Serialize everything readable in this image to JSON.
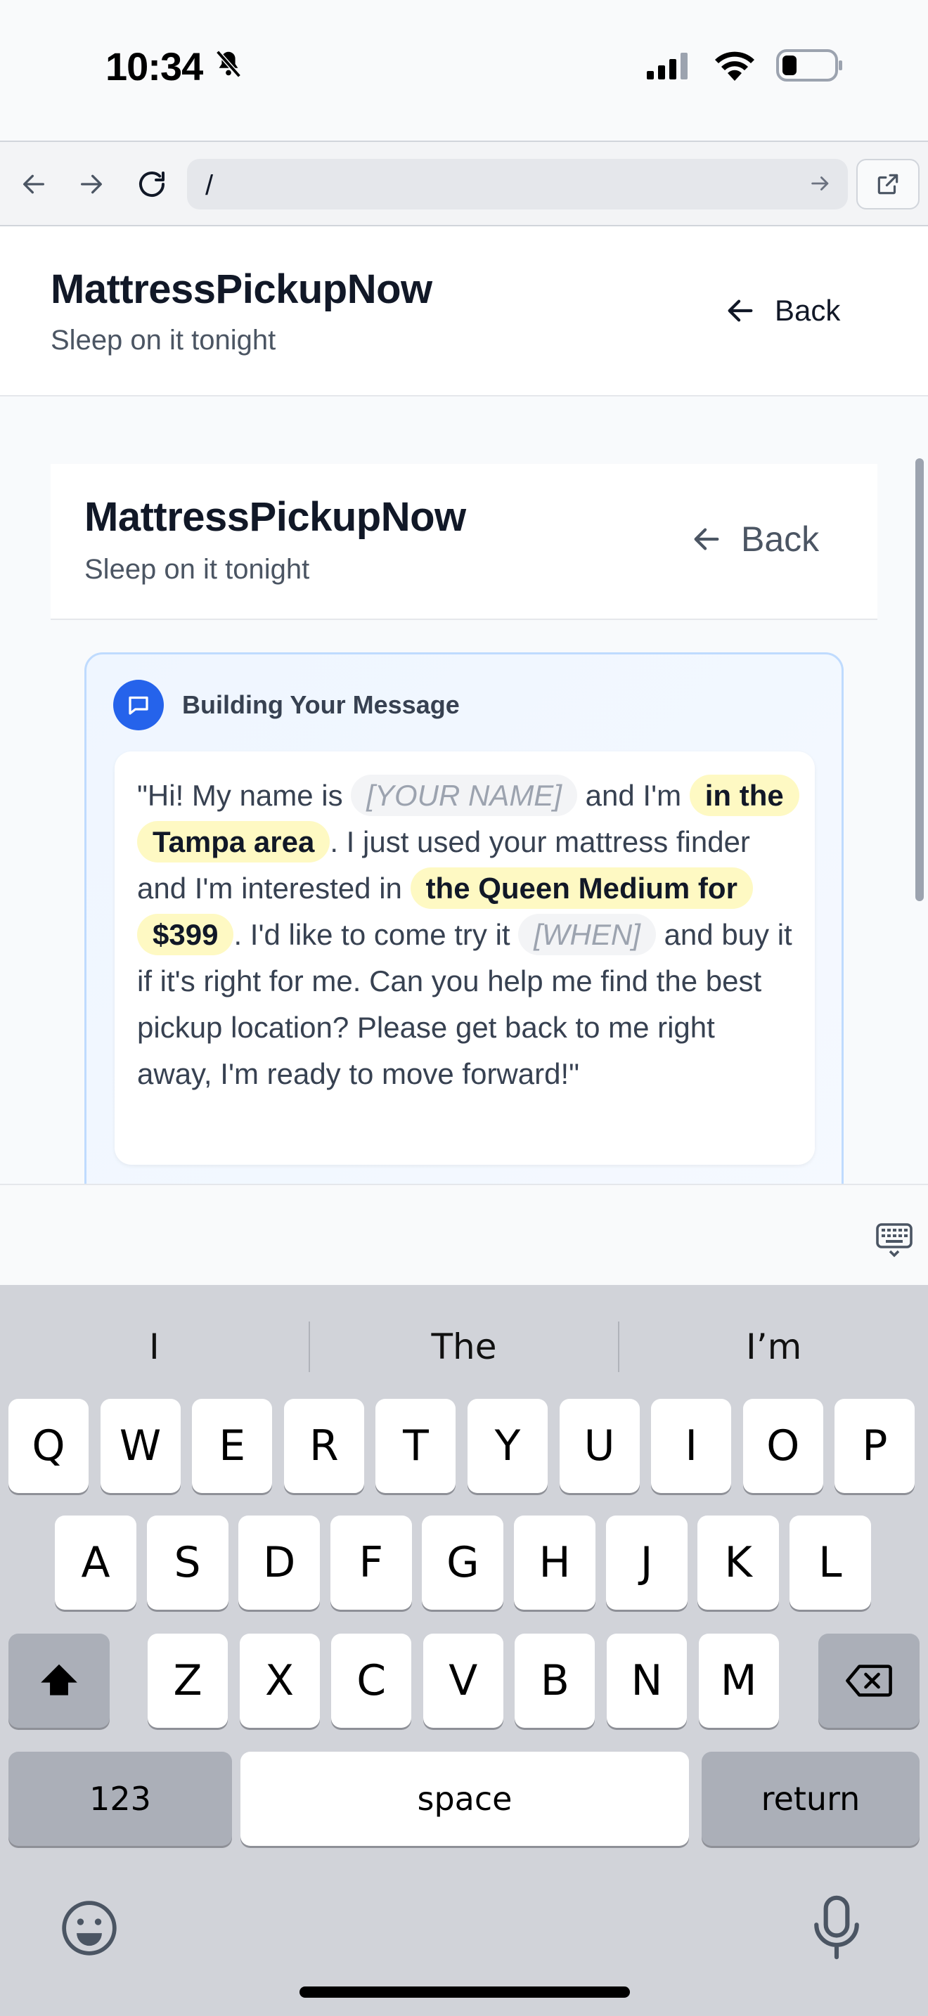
{
  "status": {
    "time": "10:34"
  },
  "browser": {
    "url": "/"
  },
  "header": {
    "title": "MattressPickupNow",
    "subtitle": "Sleep on it tonight",
    "back_label": "Back"
  },
  "inner": {
    "title": "MattressPickupNow",
    "subtitle": "Sleep on it tonight",
    "back_label": "Back"
  },
  "message": {
    "heading": "Building Your Message",
    "t1": "\"Hi! My name is ",
    "name_placeholder": "[YOUR NAME]",
    "t2": " and I'm ",
    "location": "in the Tampa area",
    "t3": ". I just used your mattress finder and I'm interested in ",
    "product": "the Queen Medium for $399",
    "t4": ". I'd like to come try it ",
    "when_placeholder": "[WHEN]",
    "t5": " and buy it if it's right for me. Can you help me find the best pickup location? Please get back to me right away, I'm ready to move forward!\""
  },
  "keyboard": {
    "suggestions": [
      "I",
      "The",
      "I’m"
    ],
    "row1": [
      "Q",
      "W",
      "E",
      "R",
      "T",
      "Y",
      "U",
      "I",
      "O",
      "P"
    ],
    "row2": [
      "A",
      "S",
      "D",
      "F",
      "G",
      "H",
      "J",
      "K",
      "L"
    ],
    "row3": [
      "Z",
      "X",
      "C",
      "V",
      "B",
      "N",
      "M"
    ],
    "numbers_label": "123",
    "space_label": "space",
    "return_label": "return"
  }
}
